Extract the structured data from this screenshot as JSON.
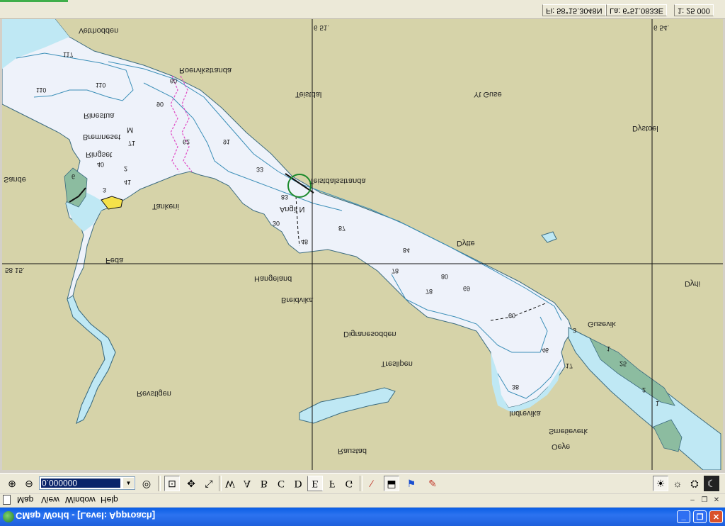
{
  "coords": {
    "lat": "Fi: 58°15.3048N",
    "lon": "La: 6°51.0833E",
    "scale": "1: 25 000"
  },
  "grid": {
    "top_left": "6 51.",
    "top_right": "6 54.",
    "left_mid": "58 15."
  },
  "places": [
    "Vetrhodden",
    "Roervikstranda",
    "Teistdal",
    "Yt Guse",
    "Dystoel",
    "Rinestua",
    "Bremneset",
    "M",
    "Ringset",
    "Sande",
    "Teistdalsstranda",
    "Tankeni",
    "Angil N",
    "Dytte",
    "Feda",
    "Hangeland",
    "Breidvika",
    "Dyrli",
    "Gusevik",
    "Digranesodden",
    "Treslipen",
    "Revstigen",
    "Indrevika",
    "Smetieverk",
    "Oeye",
    "Raustad"
  ],
  "depths": [
    "117",
    "110",
    "110",
    "90",
    "71",
    "60",
    "62",
    "91",
    "40",
    "2",
    "41",
    "6",
    "3",
    "33",
    "83",
    "30",
    "87",
    "48",
    "84",
    "78",
    "80",
    "69",
    "78",
    "60",
    "46",
    "38",
    "3",
    "1",
    "25",
    "2",
    "1",
    "17",
    "61",
    "50",
    "17",
    "2"
  ],
  "toolbar": {
    "zoom_value": "0.000000",
    "letters": [
      "W",
      "A",
      "B",
      "C",
      "D",
      "E",
      "F",
      "G"
    ]
  },
  "menu": {
    "items": [
      "Map",
      "View",
      "Window",
      "Help"
    ]
  },
  "window": {
    "title": "CMap World - [Level: Approach]"
  },
  "colors": {
    "land": "#d6d3a9",
    "water": "#eef2fa",
    "shallow": "#bfe8f4",
    "marsh": "#8cbca0",
    "contour": "#3c8fb8",
    "cable": "#e04ac4",
    "titlebar": "#0a5ee4"
  }
}
